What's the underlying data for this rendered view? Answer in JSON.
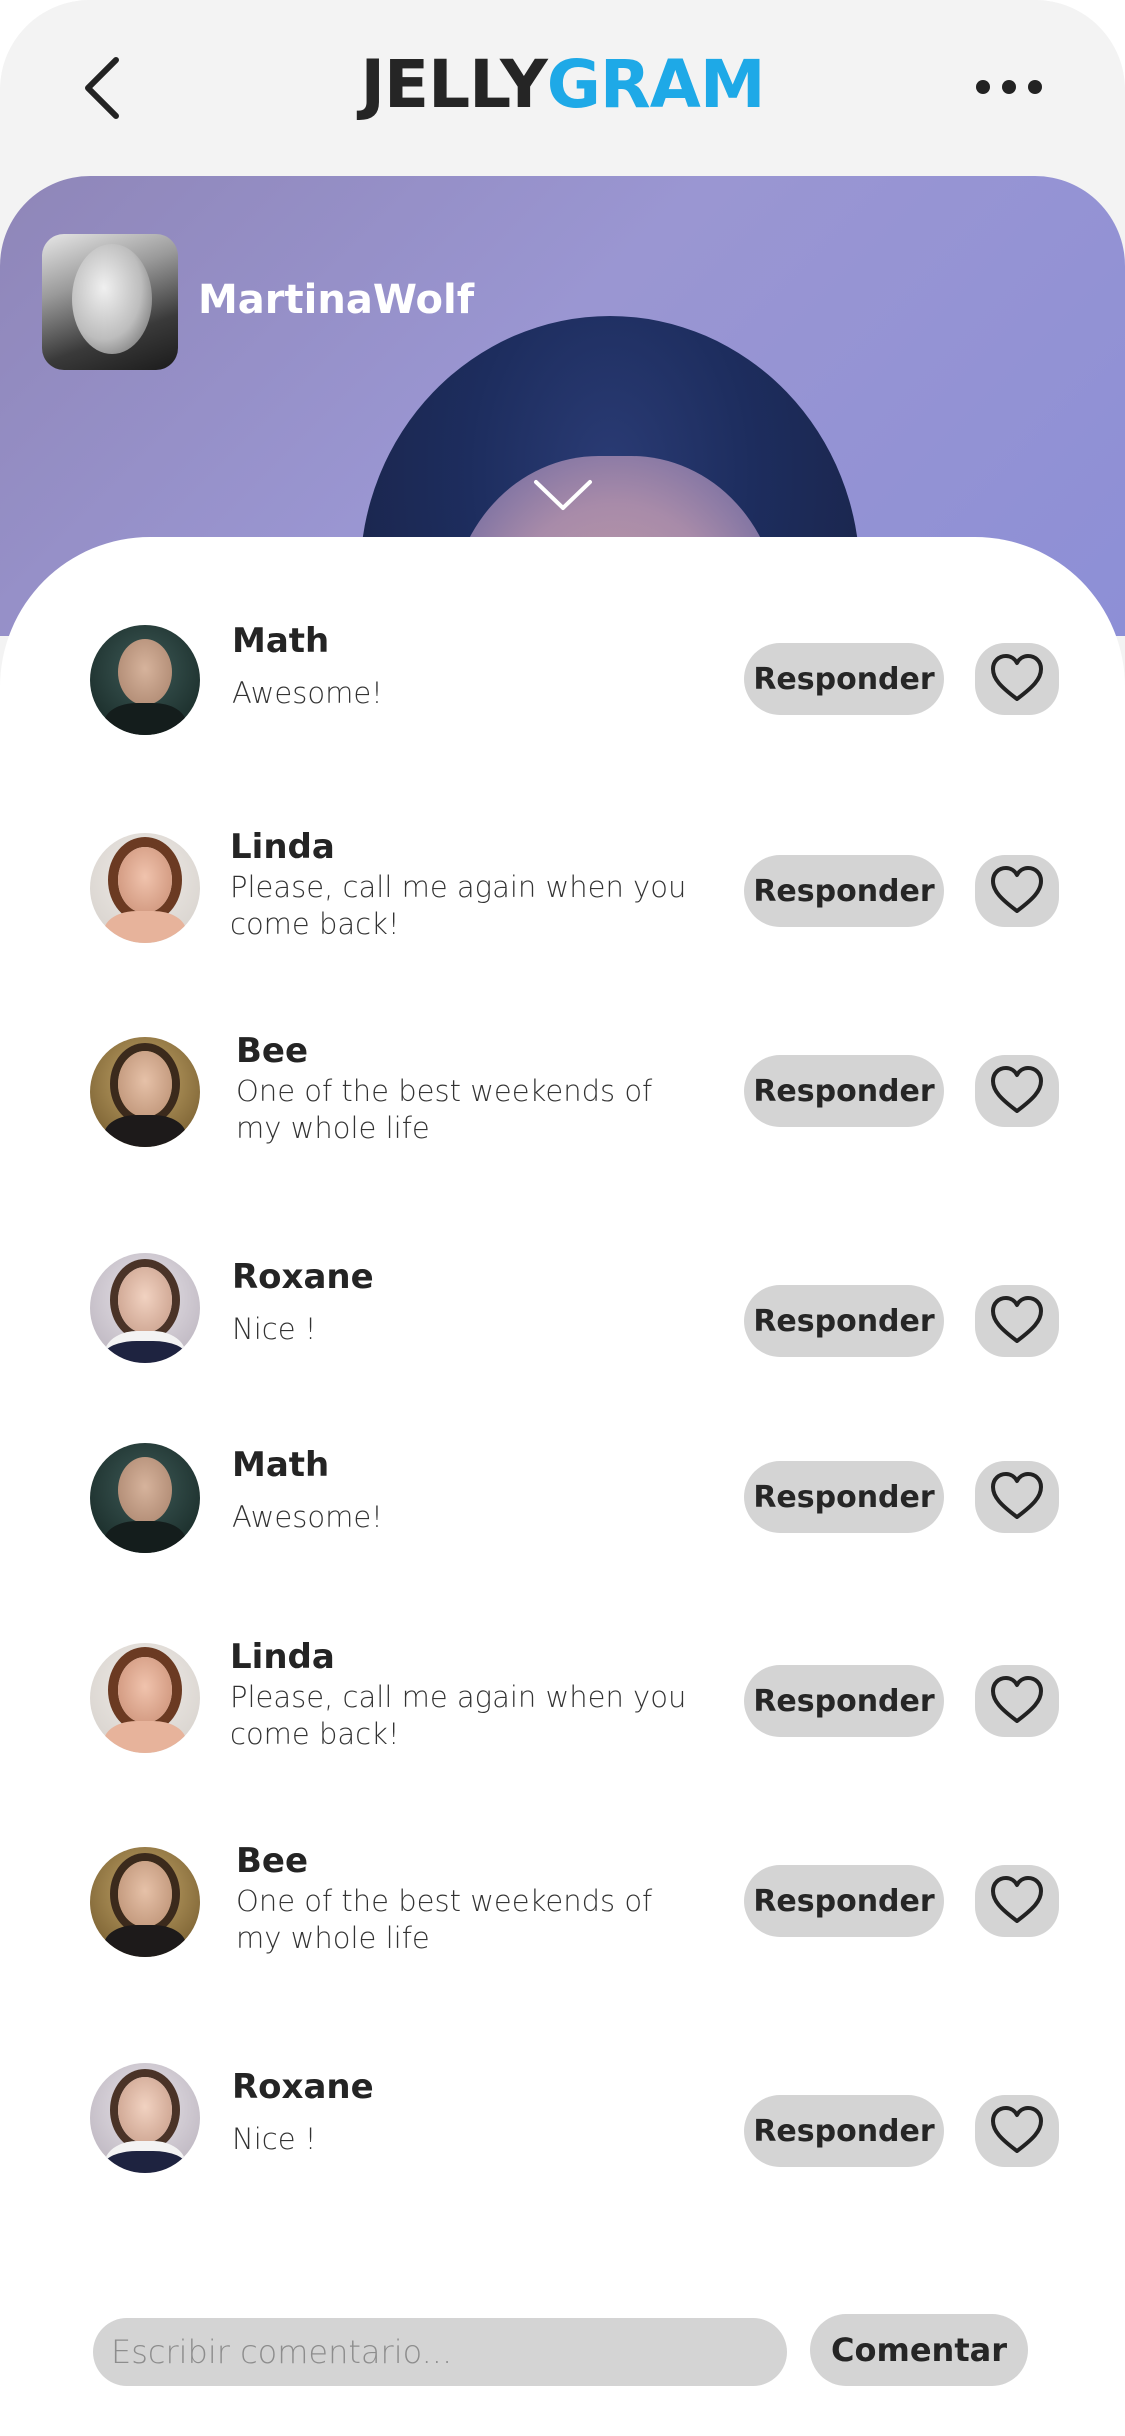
{
  "header": {
    "logo_part1": "JELLY",
    "logo_part2": "GRAM",
    "back_icon": "chevron-left-icon",
    "more_icon": "more-horizontal-icon"
  },
  "post": {
    "username": "MartinaWolf",
    "collapse_icon": "chevron-down-icon"
  },
  "comments": [
    {
      "name": "Math",
      "text": "Awesome!",
      "reply_label": "Responder"
    },
    {
      "name": "Linda",
      "text": "Please, call me again when you come back!",
      "reply_label": "Responder"
    },
    {
      "name": "Bee",
      "text": "One of the best weekends of my whole life",
      "reply_label": "Responder"
    },
    {
      "name": "Roxane",
      "text": "Nice !",
      "reply_label": "Responder"
    },
    {
      "name": "Math",
      "text": "Awesome!",
      "reply_label": "Responder"
    },
    {
      "name": "Linda",
      "text": "Please, call me again when you come back!",
      "reply_label": "Responder"
    },
    {
      "name": "Bee",
      "text": "One of the best weekends of my whole life",
      "reply_label": "Responder"
    },
    {
      "name": "Roxane",
      "text": "Nice !",
      "reply_label": "Responder"
    }
  ],
  "composer": {
    "placeholder": "Escribir comentario...",
    "value": "",
    "submit_label": "Comentar"
  },
  "colors": {
    "brand_dark": "#252525",
    "brand_blue": "#1ea9e7",
    "button_bg": "#d4d4d4",
    "hero_purple": "#9a96d2"
  }
}
